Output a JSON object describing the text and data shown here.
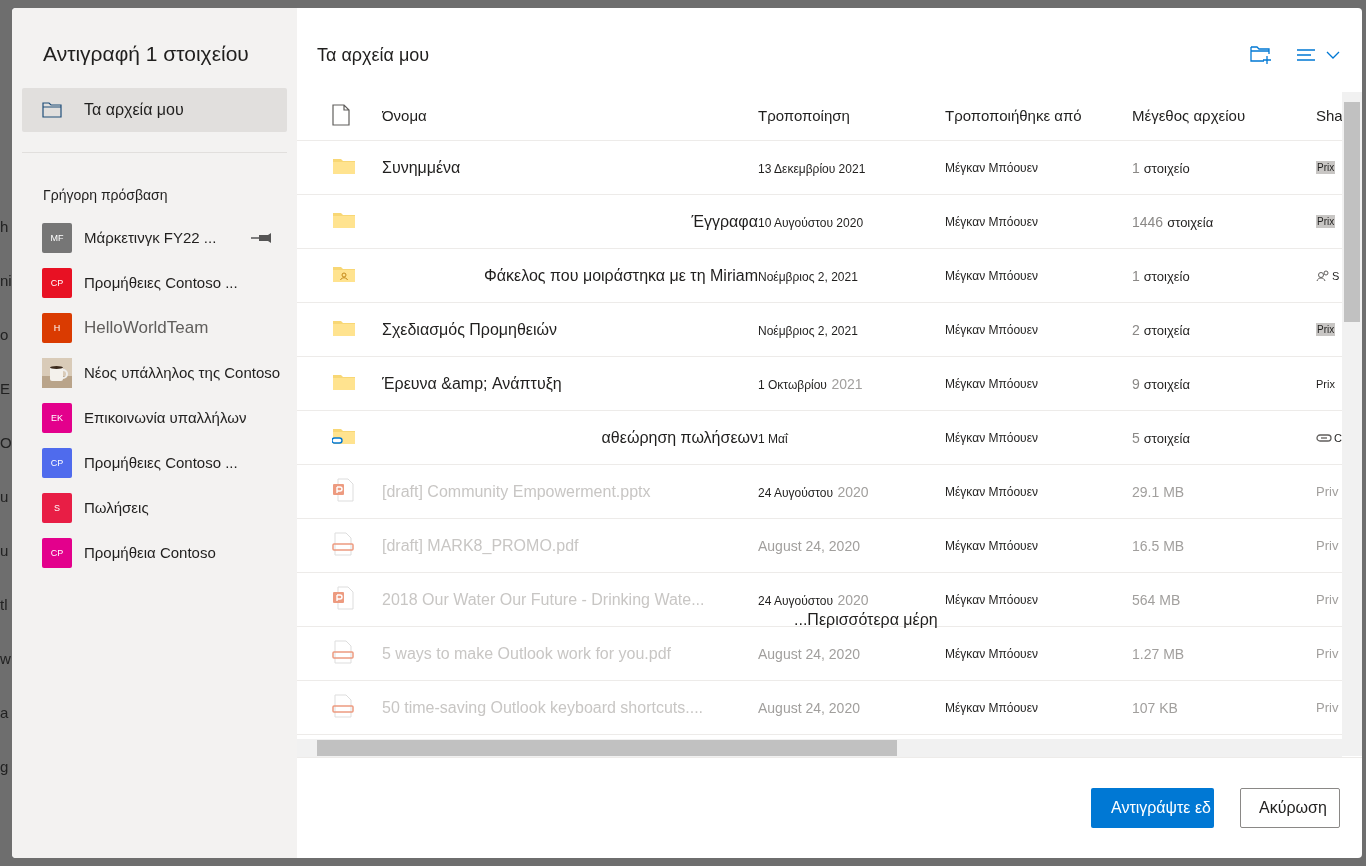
{
  "background_fragments": [
    "h",
    "ni",
    "o",
    "E",
    "O",
    "u",
    "u",
    "tl",
    "w",
    "a",
    "g"
  ],
  "dialog": {
    "title": "Αντιγραφή 1 στοιχείου",
    "nav": [
      {
        "label": "Τα αρχεία μου",
        "selected": true
      }
    ],
    "quick_access": {
      "heading": "Γρήγορη πρόσβαση",
      "items": [
        {
          "initials": "MF",
          "color": "#767676",
          "label": "Μάρκετινγκ FY22 ...",
          "pinned": true,
          "dim": false
        },
        {
          "initials": "CP",
          "color": "#e81123",
          "label": "Προμήθειες Contoso ...",
          "pinned": false,
          "dim": false
        },
        {
          "initials": "H",
          "color": "#da3b01",
          "label": "HelloWorldTeam",
          "pinned": false,
          "dim": true
        },
        {
          "kind": "picture",
          "label": "Νέος υπάλληλος της Contoso",
          "pinned": false,
          "dim": false
        },
        {
          "initials": "EK",
          "color": "#e3008c",
          "label": "Επικοινωνία υπαλλήλων",
          "pinned": false,
          "dim": false
        },
        {
          "initials": "CP",
          "color": "#4f6bed",
          "label": "Προμήθειες Contoso ...",
          "pinned": false,
          "dim": false
        },
        {
          "initials": "S",
          "color": "#e81e45",
          "label": "Πωλήσεις",
          "pinned": false,
          "dim": false
        },
        {
          "initials": "CP",
          "color": "#e3008c",
          "label": "Προμήθεια Contoso",
          "pinned": false,
          "dim": false
        }
      ]
    },
    "location": "Τα αρχεία μου",
    "table": {
      "columns": [
        "Όνομα",
        "Τροποποίηση",
        "Τροποποιήθηκε από",
        "Μέγεθος αρχείου",
        "Sha"
      ],
      "rows": [
        {
          "kind": "folder",
          "name": "Συνημμένα",
          "name_right": false,
          "date": "13 Δεκεμβρίου 2021",
          "by": "Μέγκαν Μπόουεν",
          "count": "1",
          "size": "στοιχείο",
          "sharing": {
            "kind": "badge",
            "text": "Prix"
          },
          "disabled": false
        },
        {
          "kind": "folder",
          "name": "Έγγραφα",
          "name_right": true,
          "date": "10 Αυγούστου 2020",
          "by": "Μέγκαν Μπόουεν",
          "count": "1446",
          "size": "στοιχεία",
          "sharing": {
            "kind": "badge",
            "text": "Prix"
          },
          "disabled": false
        },
        {
          "kind": "shared-folder",
          "name": "Φάκελος που μοιράστηκα με τη Miriam",
          "name_right": true,
          "date": "Νοέμβριος 2, 2021",
          "by": "Μέγκαν Μπόουεν",
          "count": "1",
          "size": "στοιχείο",
          "sharing": {
            "kind": "people",
            "text": "S"
          },
          "disabled": false
        },
        {
          "kind": "folder",
          "name": "Σχεδιασμός Προμηθειών",
          "name_right": false,
          "date": "Νοέμβριος 2, 2021",
          "by": "Μέγκαν Μπόουεν",
          "count": "2",
          "size": "στοιχεία",
          "sharing": {
            "kind": "badge",
            "text": "Prix"
          },
          "disabled": false
        },
        {
          "kind": "folder",
          "name": "Έρευνα &amp; Ανάπτυξη",
          "name_right": false,
          "date": "1 Οκτωβρίου",
          "year": "2021",
          "by": "Μέγκαν Μπόουεν",
          "count": "9",
          "size": "στοιχεία",
          "sharing": {
            "kind": "plain",
            "text": "Prix"
          },
          "disabled": false
        },
        {
          "kind": "link-folder",
          "name": "αθεώρηση πωλήσεων",
          "name_right": true,
          "date": "1 Μαΐ",
          "by": "Μέγκαν Μπόουεν",
          "count": "5",
          "size": "στοιχεία",
          "sharing": {
            "kind": "link",
            "text": "C"
          },
          "disabled": false
        },
        {
          "kind": "pptx",
          "name": "[draft] Community Empowerment.pptx",
          "name_right": false,
          "date": "24 Αυγούστου",
          "year": "2020",
          "by": "Μέγκαν Μπόουεν",
          "size": "29.1 MB",
          "sharing": {
            "kind": "plain",
            "text": "Priv"
          },
          "disabled": true
        },
        {
          "kind": "pdf",
          "name": "[draft] MARK8_PROMO.pdf",
          "name_right": false,
          "date": "August 24, 2020",
          "by": "Μέγκαν Μπόουεν",
          "size": "16.5 MB",
          "sharing": {
            "kind": "plain",
            "text": "Priv"
          },
          "disabled": true
        },
        {
          "kind": "pptx",
          "name": "2018 Our Water Our Future - Drinking Wate...",
          "name_right": false,
          "date": "24 Αυγούστου",
          "year": "2020",
          "by": "Μέγκαν Μπόουεν",
          "size": "564 MB",
          "sharing": {
            "kind": "plain",
            "text": "Priv"
          },
          "disabled": true
        },
        {
          "kind": "pdf",
          "name": "5 ways to make Outlook work for you.pdf",
          "name_right": false,
          "date": "August 24, 2020",
          "by": "Μέγκαν Μπόουεν",
          "size": "1.27 MB",
          "sharing": {
            "kind": "plain",
            "text": "Priv"
          },
          "disabled": true
        },
        {
          "kind": "pdf",
          "name": "50 time-saving Outlook keyboard shortcuts....",
          "name_right": false,
          "date": "August 24, 2020",
          "by": "Μέγκαν Μπόουεν",
          "size": "107 KB",
          "sharing": {
            "kind": "plain",
            "text": "Priv"
          },
          "disabled": true
        }
      ],
      "overlay": "...Περισσότερα μέρη"
    },
    "buttons": [
      {
        "label": "Αντιγράψτε εδ",
        "kind": "primary"
      },
      {
        "label": "Ακύρωση",
        "kind": "secondary"
      }
    ]
  }
}
